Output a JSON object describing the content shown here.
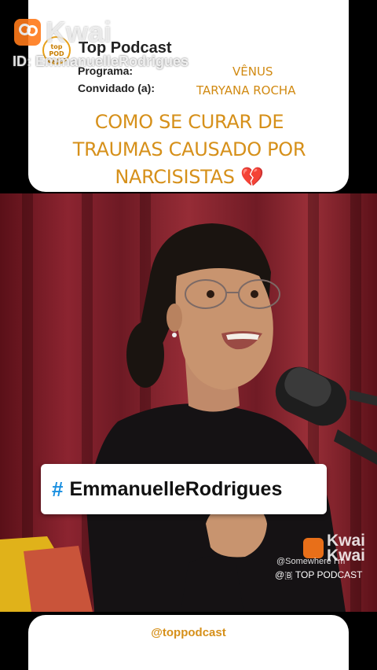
{
  "header": {
    "watermark_app": "Kwai",
    "watermark_id": "ID: EmmanuelleRodrigues",
    "logo_text": "top POD CAST",
    "podcast_name": "Top Podcast",
    "program_label": "Programa:",
    "program_value": "VÊNUS",
    "guest_label": "Convidado (a):",
    "guest_value": "TARYANA ROCHA",
    "headline_lines": [
      "COMO SE CURAR DE",
      "TRAUMAS CAUSADO POR",
      "NARCISISTAS"
    ],
    "headline_emoji": "💔"
  },
  "video": {
    "hashtag_symbol": "#",
    "hashtag_text": "EmmanuelleRodrigues",
    "kwai_label": "Kwai\nKwai",
    "handle_top": "@Somewhere I'm",
    "handle_bottom": "@🇧 TOP PODCAST"
  },
  "footer": {
    "handle": "@toppodcast"
  },
  "colors": {
    "accent_gold": "#d6901a",
    "hashtag_blue": "#1a8fe0",
    "kwai_orange": "#ff7a1a"
  }
}
